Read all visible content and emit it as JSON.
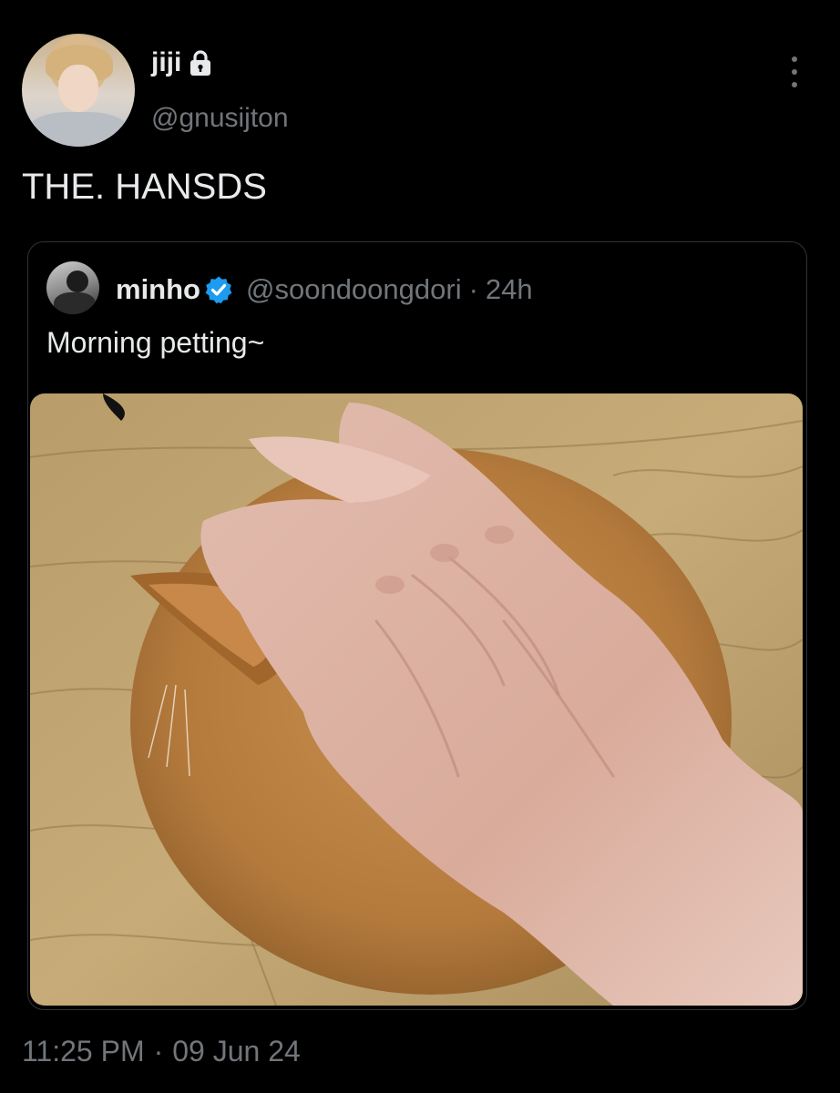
{
  "tweet": {
    "author": {
      "display_name": "jiji",
      "handle": "@gnusijton",
      "protected_icon": "lock-icon",
      "avatar": "avatar"
    },
    "text": "THE. HANSDS",
    "more_icon": "more-vertical-icon",
    "quoted_tweet": {
      "author": {
        "display_name": "minho",
        "handle": "@soondoongdori",
        "verified_icon": "verified-badge-icon",
        "verified_color": "#1d9bf0"
      },
      "separator": "·",
      "time": "24h",
      "text": "Morning petting~"
    },
    "time": "11:25 PM",
    "separator": "·",
    "date": "09 Jun 24"
  },
  "colors": {
    "background": "#000000",
    "primary_text": "#e7e9ea",
    "secondary_text": "#71767b",
    "border": "#2f3336"
  }
}
